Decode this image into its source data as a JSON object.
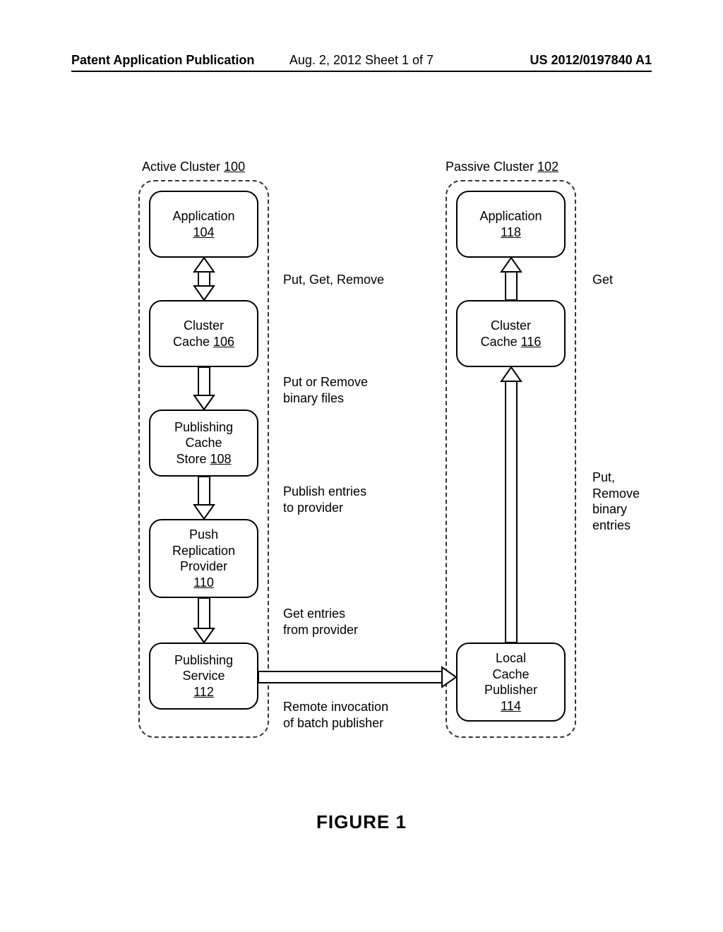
{
  "header": {
    "left": "Patent Application Publication",
    "mid": "Aug. 2, 2012  Sheet 1 of 7",
    "right": "US 2012/0197840 A1"
  },
  "figure": {
    "label": "FIGURE 1",
    "active_title": "Active Cluster ",
    "active_ref": "100",
    "passive_title": "Passive Cluster ",
    "passive_ref": "102"
  },
  "boxes": {
    "app_left": {
      "label": "Application",
      "ref": "104"
    },
    "cache_left": {
      "label": "Cluster\nCache ",
      "ref": "106"
    },
    "pub_store": {
      "label": "Publishing\nCache\nStore ",
      "ref": "108"
    },
    "push_prov": {
      "label": "Push\nReplication\nProvider",
      "ref": "110"
    },
    "pub_svc": {
      "label": "Publishing\nService",
      "ref": "112"
    },
    "local_pub": {
      "label": "Local\nCache\nPublisher",
      "ref": "114"
    },
    "cache_right": {
      "label": "Cluster\nCache ",
      "ref": "116"
    },
    "app_right": {
      "label": "Application",
      "ref": "118"
    }
  },
  "annotations": {
    "a1": "Put, Get, Remove",
    "a2": "Put or Remove\nbinary files",
    "a3": "Publish entries\nto provider",
    "a4": "Get entries\nfrom provider",
    "a5": "Remote invocation\nof batch publisher",
    "a6": "Get",
    "a7": "Put, Remove\nbinary entries"
  }
}
